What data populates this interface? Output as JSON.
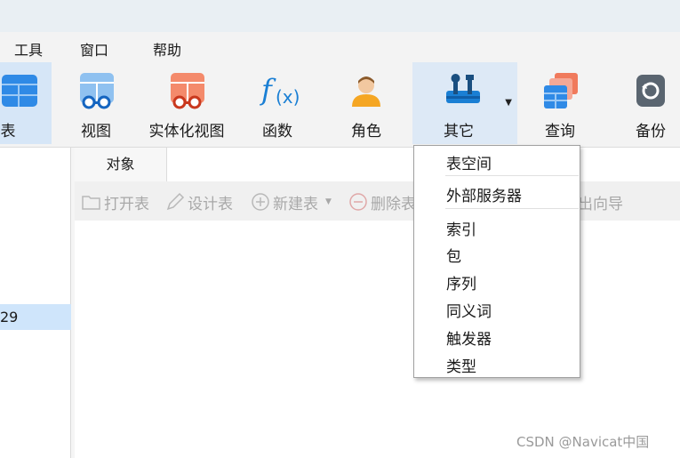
{
  "menu": {
    "tools": "工具",
    "window": "窗口",
    "help": "帮助"
  },
  "toolbar": {
    "table_partial": "表",
    "view": "视图",
    "materialized_view": "实体化视图",
    "function": "函数",
    "role": "角色",
    "others": "其它",
    "query": "查询",
    "backup": "备份"
  },
  "sidebar": {
    "selected_item_partial": "29"
  },
  "tabs": {
    "objects": "对象"
  },
  "object_toolbar": {
    "open_table": "打开表",
    "design_table": "设计表",
    "new_table": "新建表",
    "delete_table_partial": "删除表",
    "wizard_partial": "出向导"
  },
  "others_menu": {
    "items": [
      "表空间",
      "外部服务器",
      "索引",
      "包",
      "序列",
      "同义词",
      "触发器",
      "类型"
    ]
  },
  "watermark": "CSDN @Navicat中国",
  "colors": {
    "accent": "#1a7fd4",
    "highlight": "#cfe5fb"
  }
}
